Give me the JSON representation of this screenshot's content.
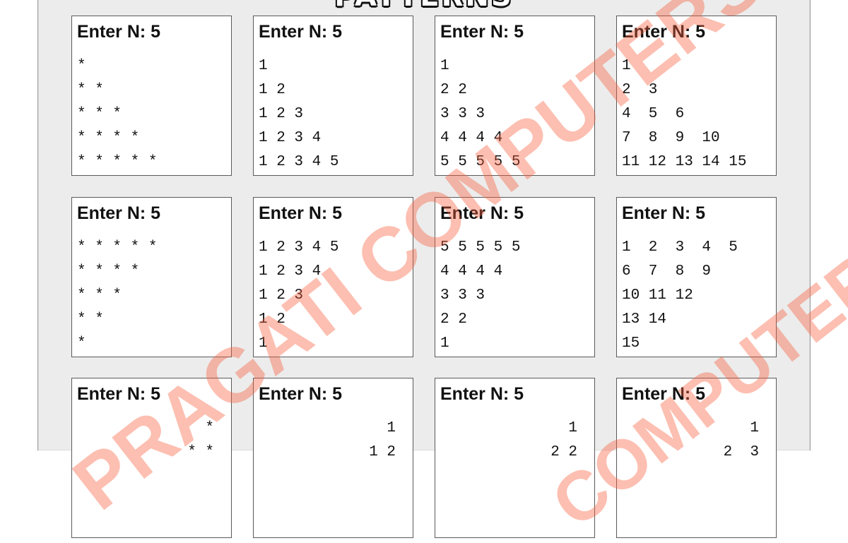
{
  "title": "PATTERNS",
  "watermark": {
    "main": "PRAGATI COMPUTERS",
    "secondary": "COMPUTERS",
    "color": "#f8603c"
  },
  "boxes": [
    {
      "header": "Enter N: 5",
      "lines": [
        "*",
        "* *",
        "* * *",
        "* * * *",
        "* * * * *"
      ]
    },
    {
      "header": "Enter N: 5",
      "lines": [
        "1",
        "1 2",
        "1 2 3",
        "1 2 3 4",
        "1 2 3 4 5"
      ]
    },
    {
      "header": "Enter N: 5",
      "lines": [
        "1",
        "2 2",
        "3 3 3",
        "4 4 4 4",
        "5 5 5 5 5"
      ]
    },
    {
      "header": "Enter N: 5",
      "lines": [
        "1",
        "2  3",
        "4  5  6",
        "7  8  9  10",
        "11 12 13 14 15"
      ]
    },
    {
      "header": "Enter N: 5",
      "lines": [
        "* * * * *",
        "* * * *",
        "* * *",
        "* *",
        "*"
      ]
    },
    {
      "header": "Enter N: 5",
      "lines": [
        "1 2 3 4 5",
        "1 2 3 4",
        "1 2 3",
        "1 2",
        "1"
      ]
    },
    {
      "header": "Enter N: 5",
      "lines": [
        "5 5 5 5 5",
        "4 4 4 4",
        "3 3 3",
        "2 2",
        "1"
      ]
    },
    {
      "header": "Enter N: 5",
      "lines": [
        "1  2  3  4  5",
        "6  7  8  9",
        "10 11 12",
        "13 14",
        "15"
      ]
    },
    {
      "header": "Enter N: 5",
      "lines": [
        "*",
        "* *"
      ]
    },
    {
      "header": "Enter N: 5",
      "lines": [
        "1",
        "1 2"
      ]
    },
    {
      "header": "Enter N: 5",
      "lines": [
        "1",
        "2 2"
      ]
    },
    {
      "header": "Enter N: 5",
      "lines": [
        "1",
        "2  3"
      ]
    }
  ]
}
